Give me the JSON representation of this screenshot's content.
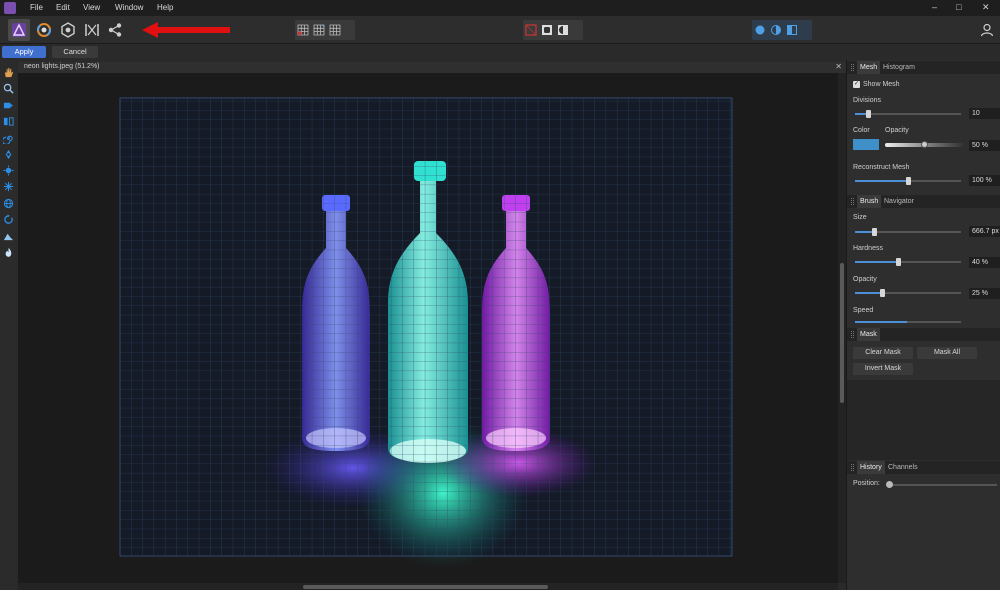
{
  "menu": {
    "items": [
      "File",
      "Edit",
      "View",
      "Window",
      "Help"
    ]
  },
  "window_controls": {
    "minimize": "–",
    "maximize": "□",
    "close": "✕"
  },
  "toolbar": {
    "personas": [
      {
        "icon": "affinity-photo-persona-icon"
      },
      {
        "icon": "liquify-persona-icon"
      },
      {
        "icon": "develop-persona-icon"
      },
      {
        "icon": "tone-mapping-persona-icon"
      },
      {
        "icon": "export-persona-icon"
      }
    ],
    "arrow_color": "#e01010"
  },
  "context": {
    "apply_label": "Apply",
    "cancel_label": "Cancel"
  },
  "document": {
    "tab_title": "neon lights.jpeg (51.2%)",
    "close": "✕"
  },
  "mesh_panel": {
    "tabs": [
      "Mesh",
      "Histogram"
    ],
    "show_mesh_label": "Show Mesh",
    "show_mesh_checked": true,
    "divisions_label": "Divisions",
    "divisions_value": "10",
    "color_label": "Color",
    "opacity_label": "Opacity",
    "opacity_value": "50 %",
    "mesh_color": "#3f8fc8",
    "reconstruct_label": "Reconstruct Mesh",
    "reconstruct_value": "100 %"
  },
  "brush_panel": {
    "tabs": [
      "Brush",
      "Navigator"
    ],
    "size_label": "Size",
    "size_value": "666.7 px",
    "hardness_label": "Hardness",
    "hardness_value": "40 %",
    "opacity_label": "Opacity",
    "opacity_value": "25 %",
    "speed_label": "Speed"
  },
  "mask_panel": {
    "tab": "Mask",
    "clear_mask": "Clear Mask",
    "mask_all": "Mask All",
    "invert_mask": "Invert Mask"
  },
  "history_panel": {
    "tabs": [
      "History",
      "Channels"
    ],
    "position_label": "Position:"
  }
}
